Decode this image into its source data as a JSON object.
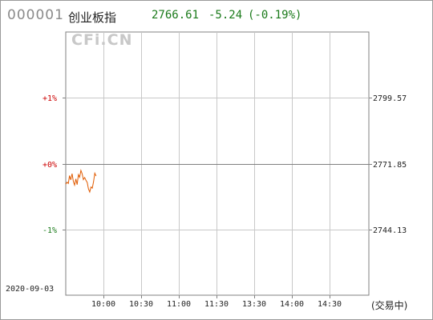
{
  "header": {
    "code": "000001",
    "name": "创业板指",
    "price": "2766.61",
    "change": "-5.24",
    "change_pct": "(-0.19%)"
  },
  "watermark": "CFi.CN",
  "date": "2020-09-03",
  "status": "(交易中)",
  "colors": {
    "up": "#cc0000",
    "down": "#1a7a1a",
    "line": "#e05a00",
    "grid": "#c8c8c8",
    "axis": "#808080"
  },
  "chart_data": {
    "type": "line",
    "x_range": [
      "09:30",
      "15:00"
    ],
    "y_range": [
      2716.41,
      2827.29
    ],
    "reference": 2771.85,
    "left_ticks": [
      {
        "label": "+1%",
        "value": 2799.57,
        "dir": "up"
      },
      {
        "label": "+0%",
        "value": 2771.85,
        "dir": "flat"
      },
      {
        "label": "-1%",
        "value": 2744.13,
        "dir": "down"
      }
    ],
    "right_ticks": [
      {
        "label": "2799.57",
        "value": 2799.57
      },
      {
        "label": "2771.85",
        "value": 2771.85
      },
      {
        "label": "2744.13",
        "value": 2744.13
      }
    ],
    "x_ticks": [
      "10:00",
      "10:30",
      "11:00",
      "11:30",
      "13:30",
      "14:00",
      "14:30"
    ],
    "series": [
      {
        "values": [
          {
            "t": 0,
            "v": 2763.2
          },
          {
            "t": 1,
            "v": 2764.0
          },
          {
            "t": 2,
            "v": 2763.5
          },
          {
            "t": 3,
            "v": 2766.8
          },
          {
            "t": 4,
            "v": 2765.0
          },
          {
            "t": 5,
            "v": 2767.6
          },
          {
            "t": 6,
            "v": 2764.3
          },
          {
            "t": 7,
            "v": 2762.8
          },
          {
            "t": 8,
            "v": 2765.4
          },
          {
            "t": 9,
            "v": 2763.0
          },
          {
            "t": 10,
            "v": 2767.2
          },
          {
            "t": 11,
            "v": 2766.1
          },
          {
            "t": 12,
            "v": 2769.0
          },
          {
            "t": 13,
            "v": 2767.5
          },
          {
            "t": 14,
            "v": 2765.1
          },
          {
            "t": 15,
            "v": 2766.0
          },
          {
            "t": 16,
            "v": 2764.8
          },
          {
            "t": 17,
            "v": 2763.9
          },
          {
            "t": 18,
            "v": 2761.2
          },
          {
            "t": 19,
            "v": 2759.9
          },
          {
            "t": 20,
            "v": 2762.0
          },
          {
            "t": 21,
            "v": 2761.5
          },
          {
            "t": 22,
            "v": 2764.3
          },
          {
            "t": 23,
            "v": 2767.8
          },
          {
            "t": 24,
            "v": 2766.61
          }
        ]
      }
    ]
  }
}
